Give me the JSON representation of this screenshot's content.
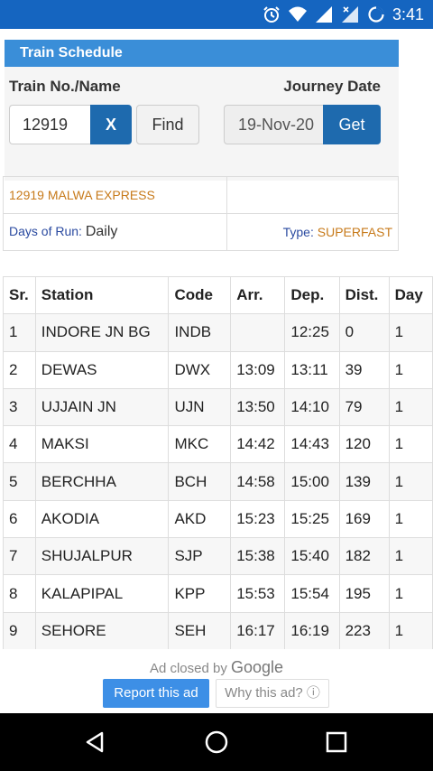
{
  "status_bar": {
    "time": "3:41"
  },
  "header": {
    "title": "Train Schedule"
  },
  "search": {
    "train_label": "Train No./Name",
    "date_label": "Journey Date",
    "train_value": "12919",
    "clear_label": "X",
    "find_label": "Find",
    "date_value": "19-Nov-20",
    "get_label": "Get"
  },
  "train_info": {
    "name": "12919 MALWA EXPRESS",
    "days_label": "Days of Run:",
    "days_value": "Daily",
    "type_label": "Type:",
    "type_value": "SUPERFAST"
  },
  "schedule": {
    "headers": [
      "Sr.",
      "Station",
      "Code",
      "Arr.",
      "Dep.",
      "Dist.",
      "Day"
    ],
    "rows": [
      [
        "1",
        "INDORE JN BG",
        "INDB",
        "",
        "12:25",
        "0",
        "1"
      ],
      [
        "2",
        "DEWAS",
        "DWX",
        "13:09",
        "13:11",
        "39",
        "1"
      ],
      [
        "3",
        "UJJAIN JN",
        "UJN",
        "13:50",
        "14:10",
        "79",
        "1"
      ],
      [
        "4",
        "MAKSI",
        "MKC",
        "14:42",
        "14:43",
        "120",
        "1"
      ],
      [
        "5",
        "BERCHHA",
        "BCH",
        "14:58",
        "15:00",
        "139",
        "1"
      ],
      [
        "6",
        "AKODIA",
        "AKD",
        "15:23",
        "15:25",
        "169",
        "1"
      ],
      [
        "7",
        "SHUJALPUR",
        "SJP",
        "15:38",
        "15:40",
        "182",
        "1"
      ],
      [
        "8",
        "KALAPIPAL",
        "KPP",
        "15:53",
        "15:54",
        "195",
        "1"
      ],
      [
        "9",
        "SEHORE",
        "SEH",
        "16:17",
        "16:19",
        "223",
        "1"
      ],
      [
        "",
        "",
        "",
        "",
        "",
        "",
        ""
      ]
    ]
  },
  "ad": {
    "closed_text": "Ad closed by",
    "brand": "Google",
    "report_label": "Report this ad",
    "why_label": "Why this ad? ⓘ"
  },
  "colors": {
    "status_bar": "#1565c0",
    "header": "#3a8ed8",
    "button": "#1e6aae",
    "accent_orange": "#c77a1a"
  }
}
